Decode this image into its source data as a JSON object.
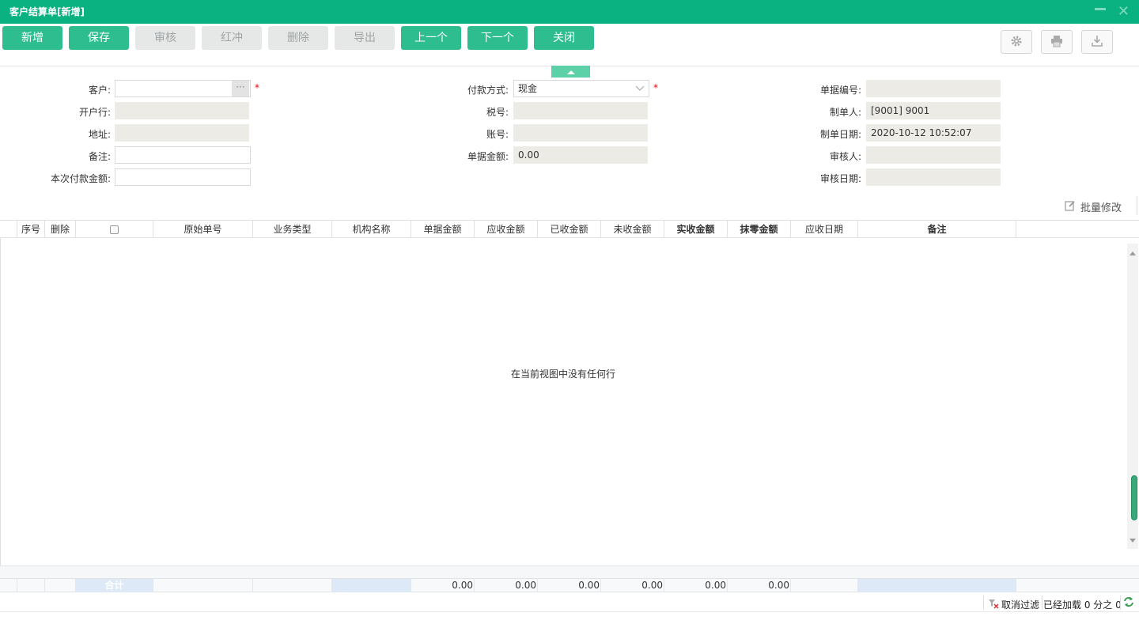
{
  "window": {
    "title": "客户结算单[新增]"
  },
  "toolbar": {
    "buttons": [
      {
        "label": "新增",
        "enabled": true
      },
      {
        "label": "保存",
        "enabled": true
      },
      {
        "label": "审核",
        "enabled": false
      },
      {
        "label": "红冲",
        "enabled": false
      },
      {
        "label": "删除",
        "enabled": false
      },
      {
        "label": "导出",
        "enabled": false
      },
      {
        "label": "上一个",
        "enabled": true
      },
      {
        "label": "下一个",
        "enabled": true
      },
      {
        "label": "关闭",
        "enabled": true
      }
    ],
    "icons": [
      "gear-icon",
      "printer-icon",
      "download-icon"
    ]
  },
  "form": {
    "customer": {
      "label": "客户:",
      "value": ""
    },
    "bank": {
      "label": "开户行:",
      "value": ""
    },
    "address": {
      "label": "地址:",
      "value": ""
    },
    "remark": {
      "label": "备注:",
      "value": ""
    },
    "payment_amount": {
      "label": "本次付款金额:",
      "value": ""
    },
    "payment_method": {
      "label": "付款方式:",
      "value": "现金"
    },
    "tax_no": {
      "label": "税号:",
      "value": ""
    },
    "account_no": {
      "label": "账号:",
      "value": ""
    },
    "doc_amount": {
      "label": "单据金额:",
      "value": "0.00"
    },
    "doc_no": {
      "label": "单据编号:",
      "value": ""
    },
    "creator": {
      "label": "制单人:",
      "value": "[9001] 9001"
    },
    "created_at": {
      "label": "制单日期:",
      "value": "2020-10-12 10:52:07"
    },
    "reviewer": {
      "label": "审核人:",
      "value": ""
    },
    "reviewed_at": {
      "label": "审核日期:",
      "value": ""
    },
    "required_mark": "*"
  },
  "batch_edit": {
    "label": "批量修改"
  },
  "grid": {
    "columns": [
      "序号",
      "删除",
      "",
      "原始单号",
      "业务类型",
      "机构名称",
      "单据金额",
      "应收金额",
      "已收金额",
      "未收金额",
      "实收金额",
      "抹零金额",
      "应收日期",
      "备注"
    ],
    "empty_text": "在当前视图中没有任何行",
    "total_label": "合计",
    "totals": [
      "0.00",
      "0.00",
      "0.00",
      "0.00",
      "0.00",
      "0.00"
    ]
  },
  "status": {
    "clear_filter": "取消过滤",
    "loaded": "已经加载 0 分之 0"
  }
}
